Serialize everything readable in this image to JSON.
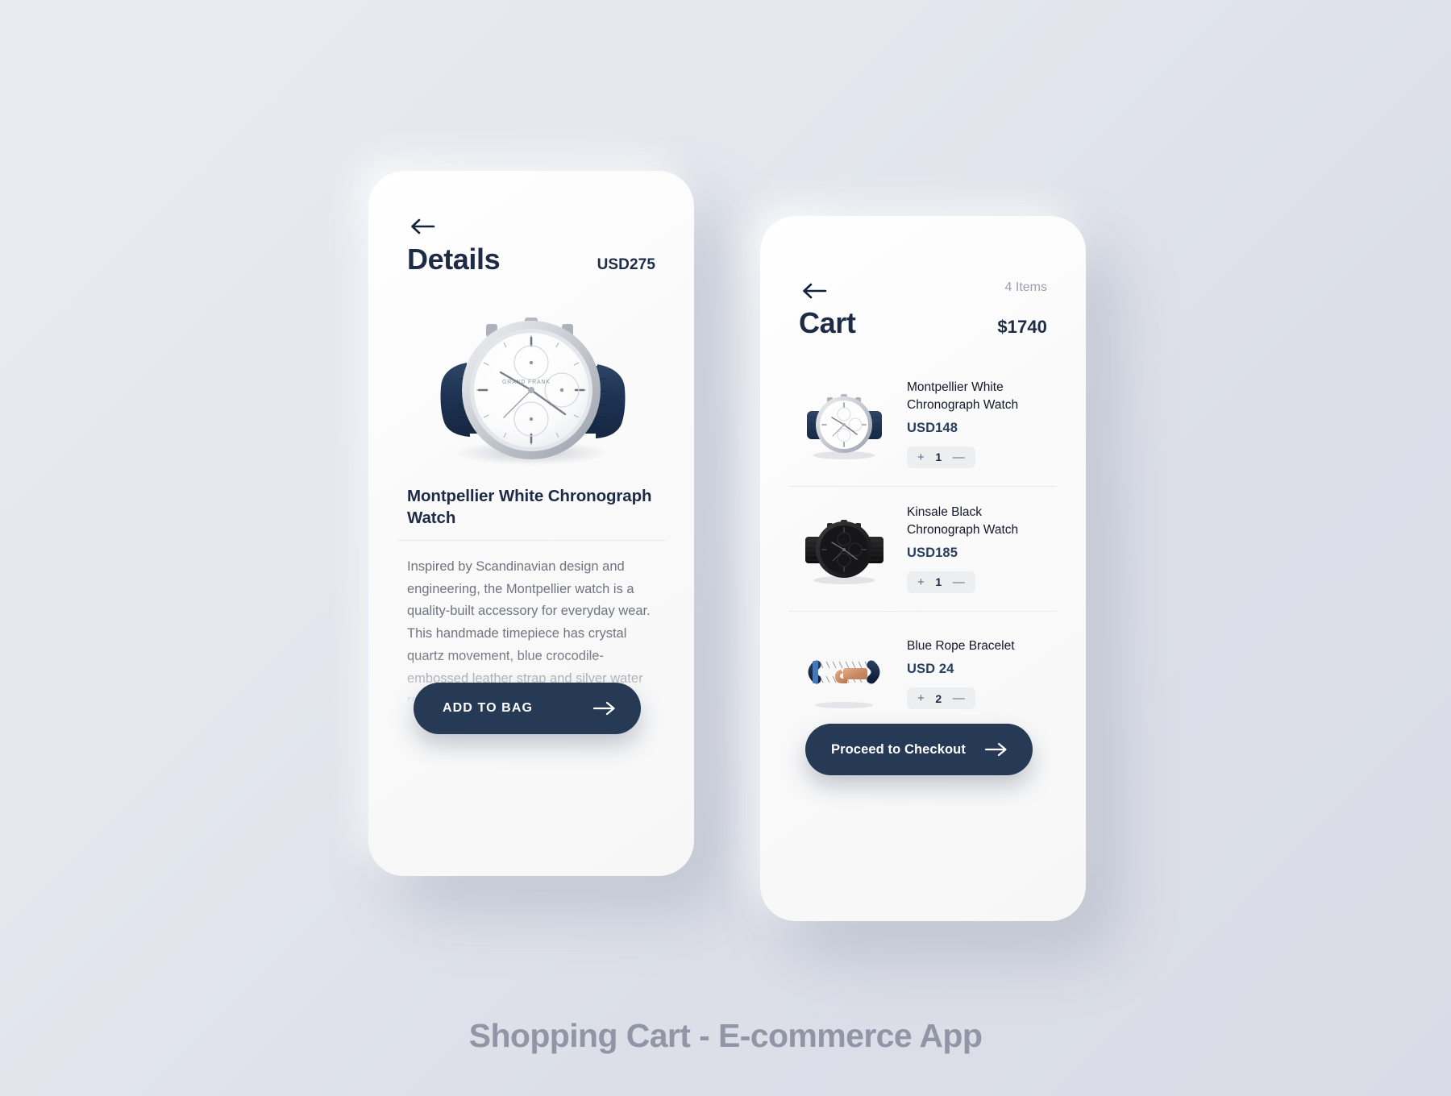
{
  "caption": "Shopping Cart - E-commerce App",
  "colors": {
    "accent": "#263a56",
    "text_dark": "#1d2b45",
    "text_muted": "#6f7480",
    "card_bg": "#fafafa",
    "page_bg": "#e4e7ee",
    "stepper_bg": "#edeef0"
  },
  "details_screen": {
    "back_icon": "arrow-left-icon",
    "title": "Details",
    "price": "USD275",
    "hero_image_alt": "Montpellier White Chronograph Watch",
    "product_title": "Montpellier White Chronograph Watch",
    "description": "Inspired by Scandinavian design and engineering, the Montpellier watch is a quality-built accessory for everyday wear. This handmade timepiece has crystal quartz movement, blue crocodile-embossed leather strap and silver water resistant stainless steel case.",
    "cta_label": "ADD TO BAG",
    "cta_icon": "arrow-right-icon"
  },
  "cart_screen": {
    "back_icon": "arrow-left-icon",
    "items_count": "4 Items",
    "title": "Cart",
    "total": "$1740",
    "items": [
      {
        "name": "Montpellier White Chronograph Watch",
        "price": "USD148",
        "quantity": "1",
        "increase_label": "+",
        "decrease_label": "—",
        "thumb_alt": "white chronograph watch with navy leather strap"
      },
      {
        "name": "Kinsale Black Chronograph Watch",
        "price": "USD185",
        "quantity": "1",
        "increase_label": "+",
        "decrease_label": "—",
        "thumb_alt": "all black chronograph watch with mesh band"
      },
      {
        "name": "Blue Rope Bracelet",
        "price": "USD 24",
        "quantity": "2",
        "increase_label": "+",
        "decrease_label": "—",
        "thumb_alt": "navy rope bracelet with rose gold hook clasp"
      }
    ],
    "cta_label": "Proceed to Checkout",
    "cta_icon": "arrow-right-icon"
  }
}
